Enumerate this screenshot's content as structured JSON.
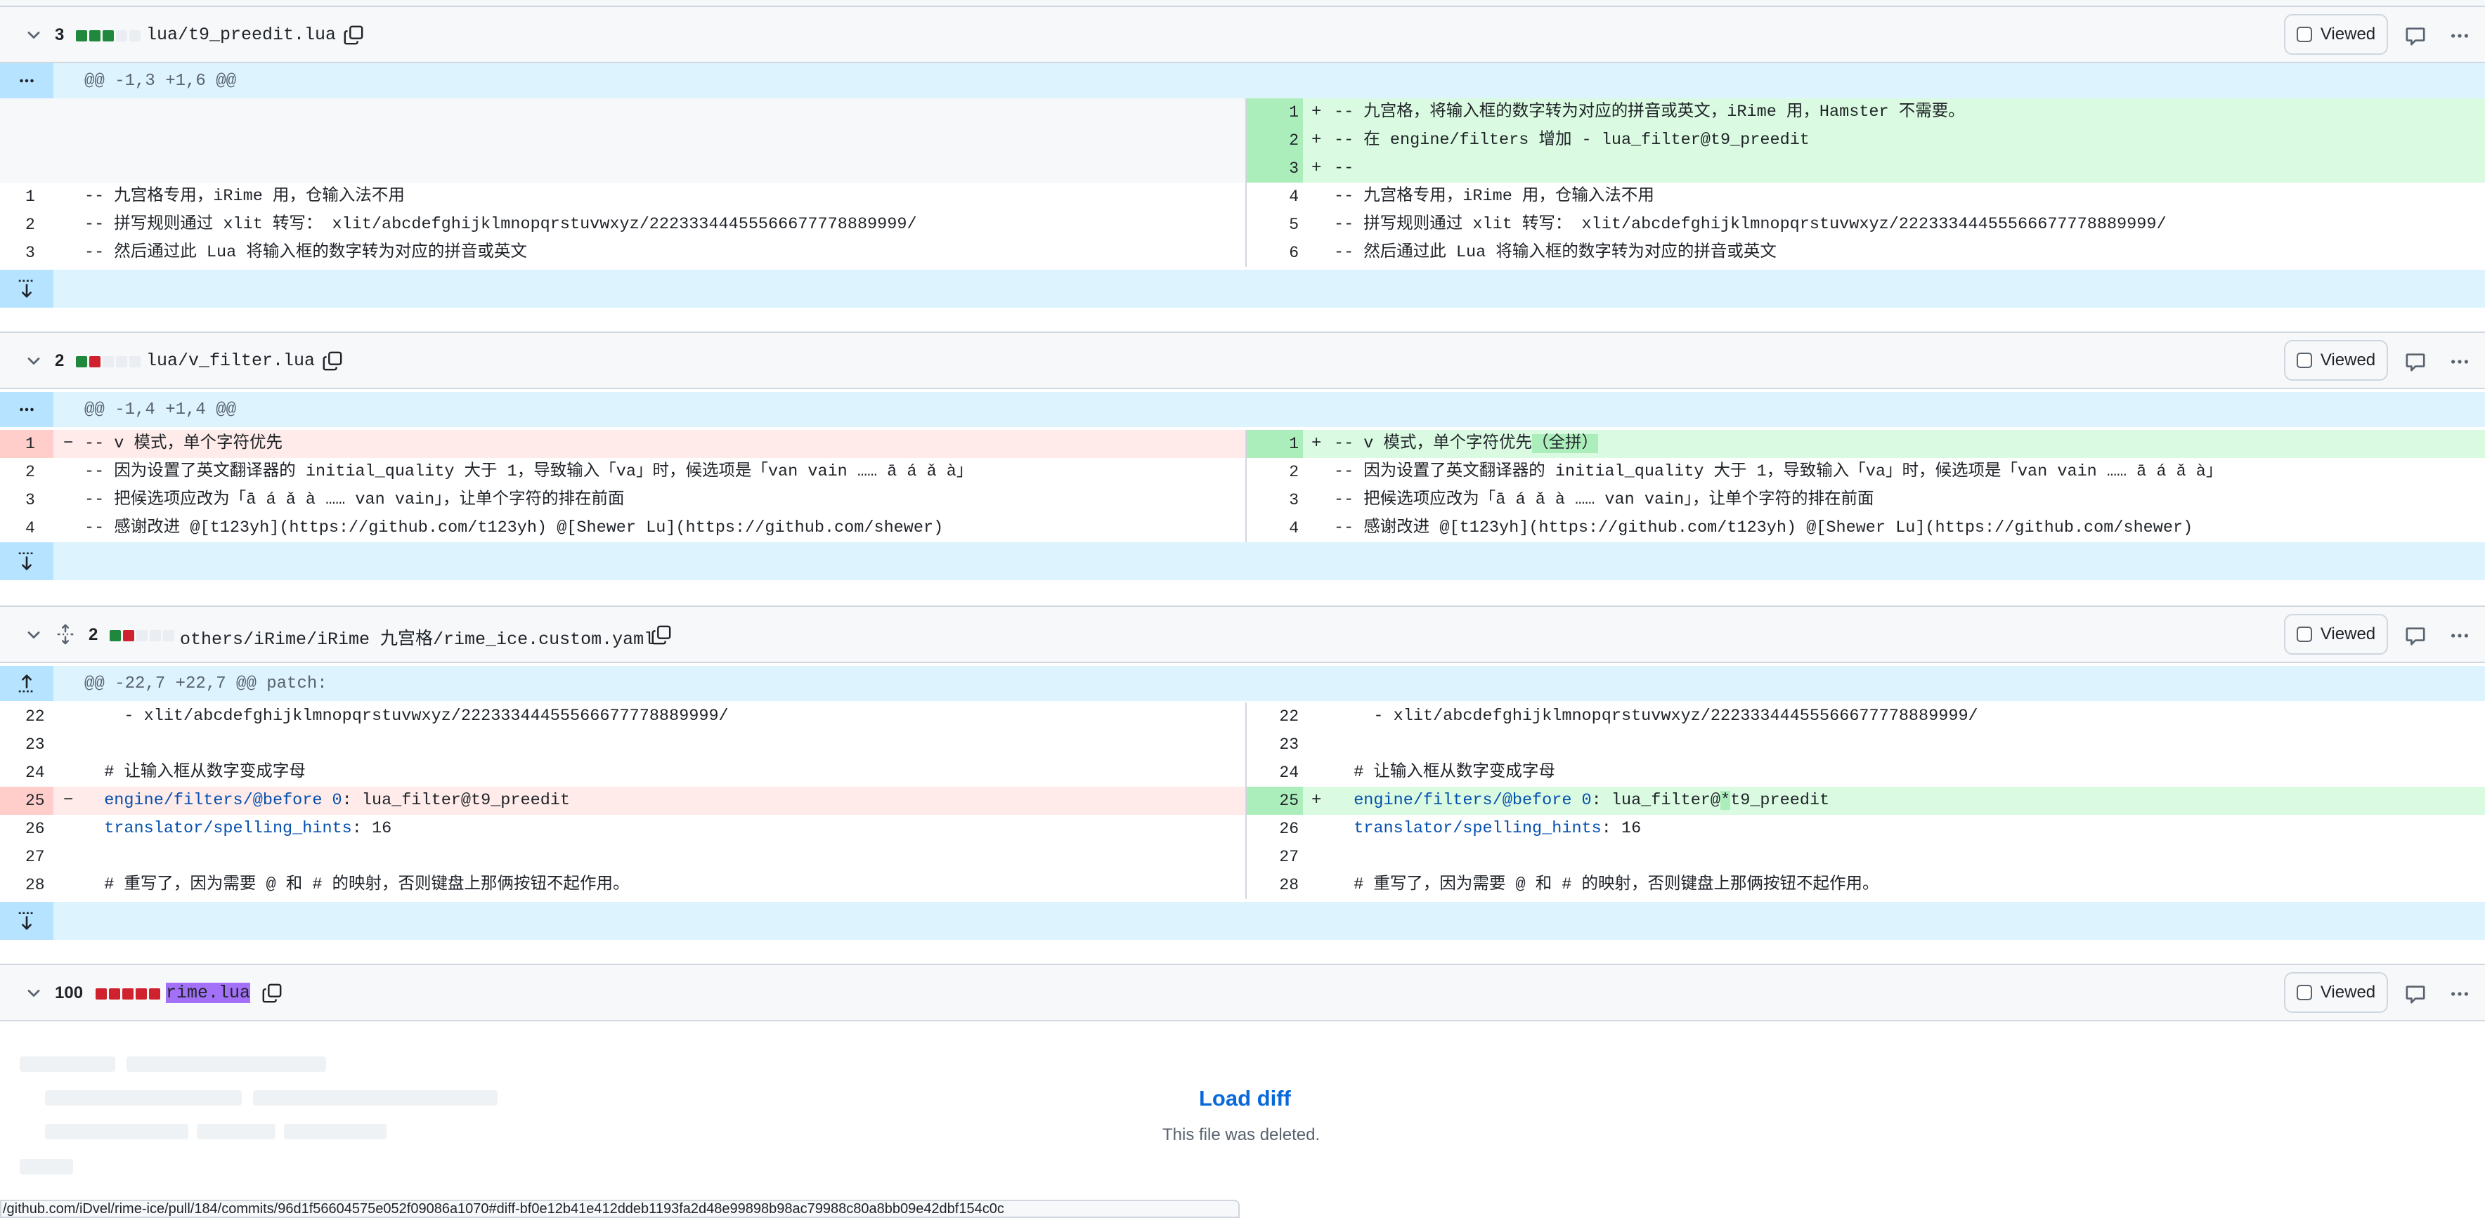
{
  "files": [
    {
      "count": "3",
      "bars": [
        "a",
        "a",
        "a",
        "n",
        "n"
      ],
      "name": "lua/t9_preedit.lua",
      "viewed_label": "Viewed",
      "hunk": "@@ -1,3 +1,6 @@",
      "rows": [
        {
          "l": null,
          "r": {
            "n": "1",
            "m": "+",
            "c": "-- 九宫格，将输入框的数字转为对应的拼音或英文，iRime 用，Hamster 不需要。",
            "t": "add"
          }
        },
        {
          "l": null,
          "r": {
            "n": "2",
            "m": "+",
            "c": "-- 在 engine/filters 增加 - lua_filter@t9_preedit",
            "t": "add"
          }
        },
        {
          "l": null,
          "r": {
            "n": "3",
            "m": "+",
            "c": "--",
            "t": "add"
          }
        },
        {
          "l": {
            "n": "1",
            "c": "-- 九宫格专用，iRime 用，仓输入法不用"
          },
          "r": {
            "n": "4",
            "c": "-- 九宫格专用，iRime 用，仓输入法不用"
          }
        },
        {
          "l": {
            "n": "2",
            "c": "-- 拼写规则通过 xlit 转写： xlit/abcdefghijklmnopqrstuvwxyz/22233344455566677778889999/"
          },
          "r": {
            "n": "5",
            "c": "-- 拼写规则通过 xlit 转写： xlit/abcdefghijklmnopqrstuvwxyz/22233344455566677778889999/"
          }
        },
        {
          "l": {
            "n": "3",
            "c": "-- 然后通过此 Lua 将输入框的数字转为对应的拼音或英文"
          },
          "r": {
            "n": "6",
            "c": "-- 然后通过此 Lua 将输入框的数字转为对应的拼音或英文"
          }
        }
      ]
    },
    {
      "count": "2",
      "bars": [
        "a",
        "d",
        "n",
        "n",
        "n"
      ],
      "name": "lua/v_filter.lua",
      "viewed_label": "Viewed",
      "hunk": "@@ -1,4 +1,4 @@",
      "rows": [
        {
          "l": {
            "n": "1",
            "m": "−",
            "c": "-- v 模式，单个字符优先",
            "t": "del"
          },
          "r": {
            "n": "1",
            "m": "+",
            "c": "-- v 模式，单个字符优先",
            "w": "（全拼）",
            "t": "add"
          }
        },
        {
          "l": {
            "n": "2",
            "c": "-- 因为设置了英文翻译器的 initial_quality 大于 1，导致输入「va」时，候选项是「van vain …… ā á ǎ à」"
          },
          "r": {
            "n": "2",
            "c": "-- 因为设置了英文翻译器的 initial_quality 大于 1，导致输入「va」时，候选项是「van vain …… ā á ǎ à」"
          }
        },
        {
          "l": {
            "n": "3",
            "c": "-- 把候选项应改为「ā á ǎ à …… van vain」，让单个字符的排在前面"
          },
          "r": {
            "n": "3",
            "c": "-- 把候选项应改为「ā á ǎ à …… van vain」，让单个字符的排在前面"
          }
        },
        {
          "l": {
            "n": "4",
            "c": "-- 感谢改进 @[t123yh](https://github.com/t123yh) @[Shewer Lu](https://github.com/shewer)"
          },
          "r": {
            "n": "4",
            "c": "-- 感谢改进 @[t123yh](https://github.com/t123yh) @[Shewer Lu](https://github.com/shewer)"
          }
        }
      ]
    },
    {
      "count": "2",
      "bars": [
        "a",
        "d",
        "n",
        "n",
        "n"
      ],
      "name": "others/iRime/iRime 九宫格/rime_ice.custom.yaml",
      "viewed_label": "Viewed",
      "hunk": "@@ -22,7 +22,7 @@ patch:",
      "rows": [
        {
          "l": {
            "n": "22",
            "c": "    - xlit/abcdefghijklmnopqrstuvwxyz/22233344455566677778889999/"
          },
          "r": {
            "n": "22",
            "c": "    - xlit/abcdefghijklmnopqrstuvwxyz/22233344455566677778889999/"
          }
        },
        {
          "l": {
            "n": "23",
            "c": ""
          },
          "r": {
            "n": "23",
            "c": ""
          }
        },
        {
          "l": {
            "n": "24",
            "c": "  # 让输入框从数字变成字母"
          },
          "r": {
            "n": "24",
            "c": "  # 让输入框从数字变成字母"
          }
        },
        {
          "l": {
            "n": "25",
            "m": "−",
            "kp": "  engine/filters/@before 0",
            "vp": ": lua_filter@t9_preedit",
            "t": "del"
          },
          "r": {
            "n": "25",
            "m": "+",
            "kp": "  engine/filters/@before 0",
            "vp": ": lua_filter@",
            "w": "*",
            "vp2": "t9_preedit",
            "t": "add"
          }
        },
        {
          "l": {
            "n": "26",
            "kp": "  translator/spelling_hints",
            "vp": ": 16"
          },
          "r": {
            "n": "26",
            "kp": "  translator/spelling_hints",
            "vp": ": 16"
          }
        },
        {
          "l": {
            "n": "27",
            "c": ""
          },
          "r": {
            "n": "27",
            "c": ""
          }
        },
        {
          "l": {
            "n": "28",
            "c": "  # 重写了，因为需要 @ 和 # 的映射，否则键盘上那俩按钮不起作用。"
          },
          "r": {
            "n": "28",
            "c": "  # 重写了，因为需要 @ 和 # 的映射，否则键盘上那俩按钮不起作用。"
          }
        }
      ]
    },
    {
      "count": "100",
      "bars": [
        "d",
        "d",
        "d",
        "d",
        "d"
      ],
      "name": "rime.lua",
      "viewed_label": "Viewed"
    }
  ],
  "load": {
    "button": "Load diff",
    "note": "This file was deleted."
  },
  "status_url": "/github.com/iDvel/rime-ice/pull/184/commits/96d1f56604575e052f09086a1070#diff-bf0e12b41e412ddeb1193fa2d48e99898b98ac79988c80a8bb09e42dbf154c0c",
  "icons": {
    "chevron": "chevron-down-icon",
    "copy": "copy-icon",
    "comment": "comment-icon",
    "kebab": "kebab-horizontal-icon",
    "expand": "unfold-icon",
    "expand_down": "fold-down-icon",
    "expand_up": "fold-up-icon",
    "expand_all": "expand-all-icon"
  },
  "colors": {
    "add_bg": "#dafbe1",
    "add_num": "#aceebb",
    "del_bg": "#ffebe9",
    "del_num": "#ffcecb",
    "hunk_bg": "#ddf4ff",
    "link": "#0969da"
  }
}
